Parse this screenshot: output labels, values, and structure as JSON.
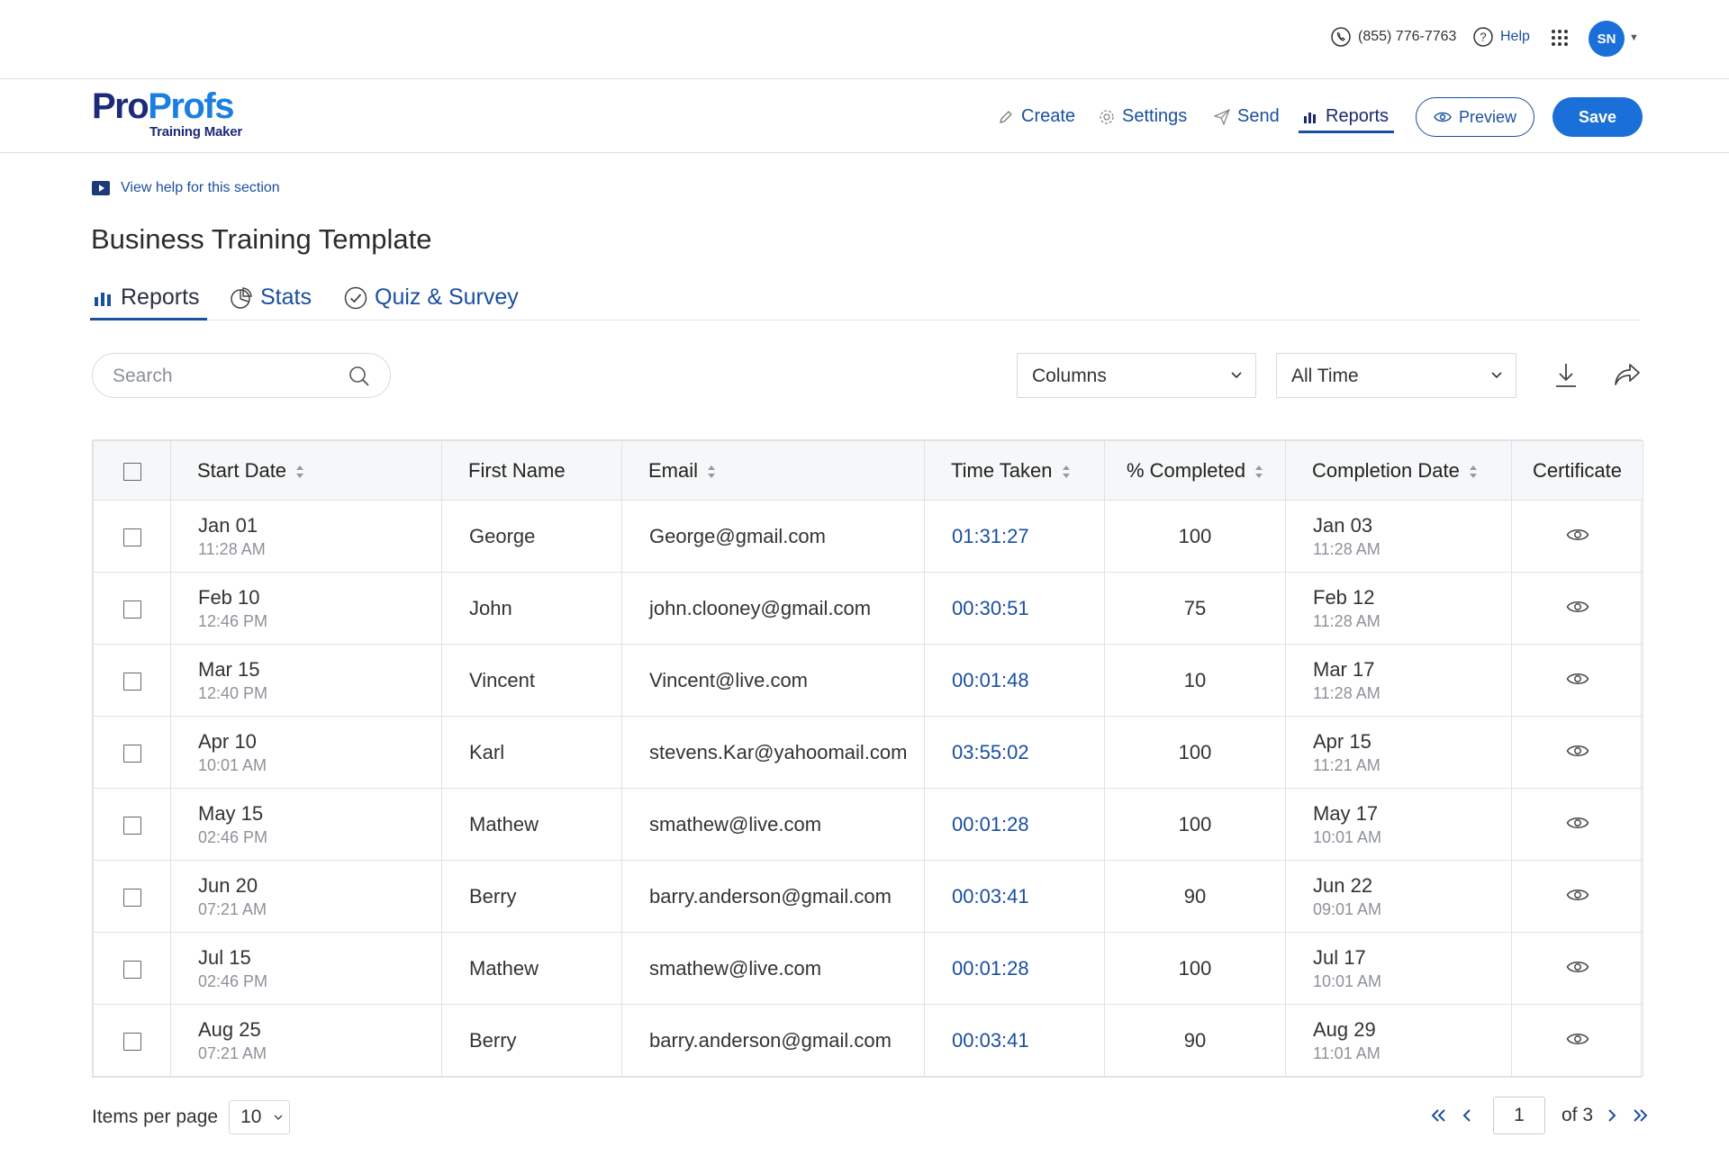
{
  "topbar": {
    "phone": "(855) 776-7763",
    "help": "Help",
    "avatar_initials": "SN"
  },
  "brand": {
    "logo_pro": "Pro",
    "logo_profs": "Profs",
    "logo_sub": "Training Maker"
  },
  "nav": {
    "create": "Create",
    "settings": "Settings",
    "send": "Send",
    "reports": "Reports",
    "preview": "Preview",
    "save": "Save"
  },
  "help_link": "View help for this section",
  "page_title": "Business Training Template",
  "tabs": [
    {
      "label": "Reports",
      "active": true
    },
    {
      "label": "Stats",
      "active": false
    },
    {
      "label": "Quiz & Survey",
      "active": false
    }
  ],
  "toolbar": {
    "search_placeholder": "Search",
    "columns_select": "Columns",
    "time_select": "All Time"
  },
  "table": {
    "headers": [
      "Start Date",
      "First Name",
      "Email",
      "Time Taken",
      "% Completed",
      "Completion Date",
      "Certificate"
    ],
    "rows": [
      {
        "start_date": "Jan 01",
        "start_time": "11:28 AM",
        "first_name": "George",
        "email": "George@gmail.com",
        "time_taken": "01:31:27",
        "completed": "100",
        "completion_date": "Jan 03",
        "completion_time": "11:28 AM"
      },
      {
        "start_date": "Feb 10",
        "start_time": "12:46 PM",
        "first_name": "John",
        "email": "john.clooney@gmail.com",
        "time_taken": "00:30:51",
        "completed": "75",
        "completion_date": "Feb 12",
        "completion_time": "11:28 AM"
      },
      {
        "start_date": "Mar 15",
        "start_time": "12:40 PM",
        "first_name": "Vincent",
        "email": "Vincent@live.com",
        "time_taken": "00:01:48",
        "completed": "10",
        "completion_date": "Mar 17",
        "completion_time": "11:28 AM"
      },
      {
        "start_date": "Apr 10",
        "start_time": "10:01 AM",
        "first_name": "Karl",
        "email": "stevens.Kar@yahoomail.com",
        "time_taken": "03:55:02",
        "completed": "100",
        "completion_date": "Apr 15",
        "completion_time": "11:21 AM"
      },
      {
        "start_date": "May 15",
        "start_time": "02:46 PM",
        "first_name": "Mathew",
        "email": "smathew@live.com",
        "time_taken": "00:01:28",
        "completed": "100",
        "completion_date": "May 17",
        "completion_time": "10:01 AM"
      },
      {
        "start_date": "Jun 20",
        "start_time": "07:21 AM",
        "first_name": "Berry",
        "email": "barry.anderson@gmail.com",
        "time_taken": "00:03:41",
        "completed": "90",
        "completion_date": "Jun 22",
        "completion_time": "09:01 AM"
      },
      {
        "start_date": "Jul 15",
        "start_time": "02:46 PM",
        "first_name": "Mathew",
        "email": "smathew@live.com",
        "time_taken": "00:01:28",
        "completed": "100",
        "completion_date": "Jul 17",
        "completion_time": "10:01 AM"
      },
      {
        "start_date": "Aug 25",
        "start_time": "07:21 AM",
        "first_name": "Berry",
        "email": "barry.anderson@gmail.com",
        "time_taken": "00:03:41",
        "completed": "90",
        "completion_date": "Aug 29",
        "completion_time": "11:01 AM"
      }
    ]
  },
  "pagination": {
    "items_per_page_label": "Items per page",
    "items_per_page": "10",
    "current_page": "1",
    "of_label": "of 3"
  },
  "icons": {
    "phone": "phone-icon",
    "help": "help-circle-icon",
    "apps": "apps-grid-icon",
    "create": "pencil-icon",
    "settings": "gear-icon",
    "send": "paper-plane-icon",
    "reports": "bar-chart-icon",
    "preview": "eye-icon",
    "help_video": "video-play-icon",
    "stats": "pie-chart-icon",
    "quiz": "check-circle-icon",
    "search": "search-icon",
    "download": "download-icon",
    "share": "share-icon",
    "certificate": "eye-icon"
  },
  "colors": {
    "primary": "#1a6fd8",
    "link": "#1b4fa0",
    "brand_dark": "#1c2a79"
  }
}
